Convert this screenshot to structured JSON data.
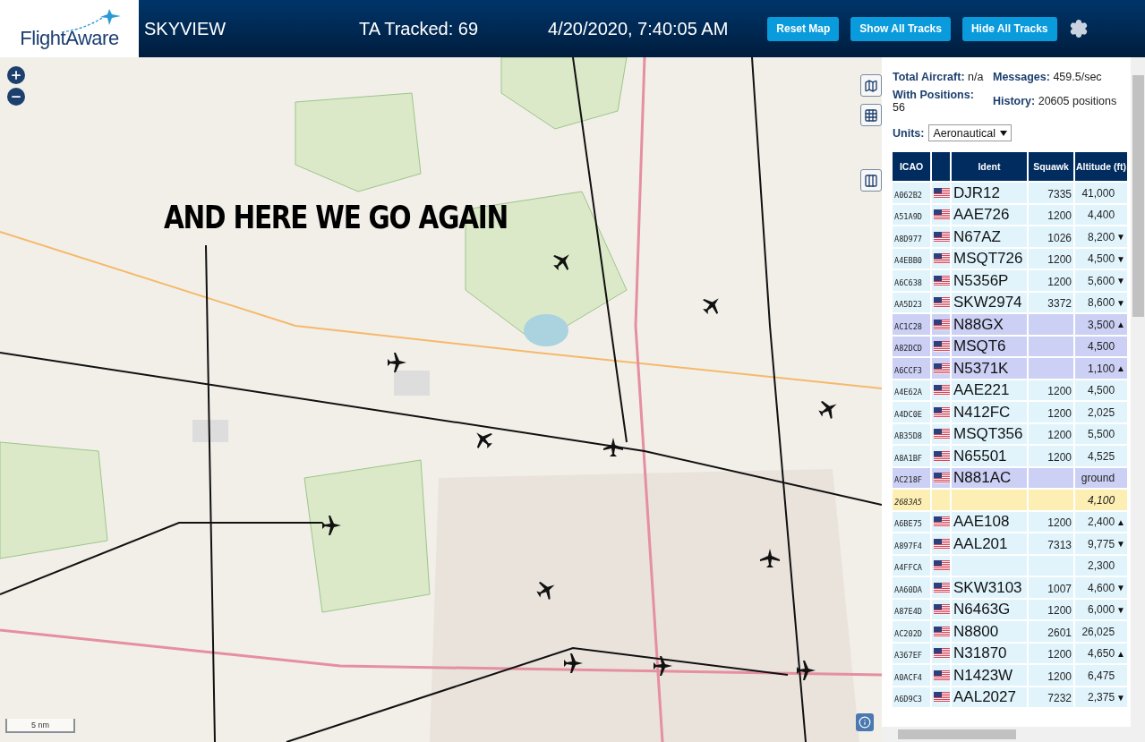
{
  "header": {
    "logo": "FlightAware",
    "title": "SKYVIEW",
    "tracked": "TA Tracked: 69",
    "datetime": "4/20/2020, 7:40:05 AM",
    "buttons": [
      "Reset Map",
      "Show All Tracks",
      "Hide All Tracks"
    ]
  },
  "map": {
    "kind": "picture",
    "caption": "AND HERE WE GO AGAIN",
    "scale": "5 nm"
  },
  "stats": [
    "**Total Aircraft:** n/a",
    "**Messages:** 459.5/sec",
    "**With Positions:** 56",
    "**History:** 20605 positions"
  ],
  "units": {
    "label": "Units:",
    "value": "Aeronautical"
  },
  "table": {
    "columns": [
      "ICAO",
      "Ident",
      "Squawk",
      "Altitude (ft)"
    ],
    "rows": [
      {
        "kind": "standard",
        "icao": "A062B2",
        "flag": true,
        "ident": "DJR12",
        "squawk": "7335",
        "altitude": "41,000"
      },
      {
        "kind": "standard",
        "icao": "A51A9D",
        "flag": true,
        "ident": "AAE726",
        "squawk": "1200",
        "altitude": "4,400"
      },
      {
        "kind": "standard",
        "icao": "A8D977",
        "flag": true,
        "ident": "N67AZ",
        "squawk": "1026",
        "altitude": "8,200",
        "trend": "▼"
      },
      {
        "kind": "standard",
        "icao": "A4EBB0",
        "flag": true,
        "ident": "MSQT726",
        "squawk": "1200",
        "altitude": "4,500",
        "trend": "▼"
      },
      {
        "kind": "standard",
        "icao": "A6C638",
        "flag": true,
        "ident": "N5356P",
        "squawk": "1200",
        "altitude": "5,600",
        "trend": "▼"
      },
      {
        "kind": "standard",
        "icao": "AA5D23",
        "flag": true,
        "ident": "SKW2974",
        "squawk": "3372",
        "altitude": "8,600",
        "trend": "▼"
      },
      {
        "kind": "highlighted",
        "icao": "AC1C28",
        "flag": true,
        "ident": "N88GX",
        "altitude": "3,500",
        "trend": "▲"
      },
      {
        "kind": "highlighted",
        "icao": "A82DCD",
        "flag": true,
        "ident": "MSQT6",
        "altitude": "4,500"
      },
      {
        "kind": "highlighted",
        "icao": "A6CCF3",
        "flag": true,
        "ident": "N5371K",
        "altitude": "1,100",
        "trend": "▲"
      },
      {
        "kind": "standard",
        "icao": "A4E62A",
        "flag": true,
        "ident": "AAE221",
        "squawk": "1200",
        "altitude": "4,500"
      },
      {
        "kind": "standard",
        "icao": "A4DC0E",
        "flag": true,
        "ident": "N412FC",
        "squawk": "1200",
        "altitude": "2,025"
      },
      {
        "kind": "standard",
        "icao": "AB35D8",
        "flag": true,
        "ident": "MSQT356",
        "squawk": "1200",
        "altitude": "5,500"
      },
      {
        "kind": "standard",
        "icao": "A8A1BF",
        "flag": true,
        "ident": "N65501",
        "squawk": "1200",
        "altitude": "4,525"
      },
      {
        "kind": "highlighted",
        "icao": "AC218F",
        "flag": true,
        "ident": "N881AC",
        "altitude": "ground"
      },
      {
        "kind": "other",
        "icao": "2683A5",
        "flag": false,
        "altitude": "4,100"
      },
      {
        "kind": "standard",
        "icao": "A6BE75",
        "flag": true,
        "ident": "AAE108",
        "squawk": "1200",
        "altitude": "2,400",
        "trend": "▲"
      },
      {
        "kind": "standard",
        "icao": "A897F4",
        "flag": true,
        "ident": "AAL201",
        "squawk": "7313",
        "altitude": "9,775",
        "trend": "▼"
      },
      {
        "kind": "standard",
        "icao": "A4FFCA",
        "flag": true,
        "altitude": "2,300"
      },
      {
        "kind": "standard",
        "icao": "AA60DA",
        "flag": true,
        "ident": "SKW3103",
        "squawk": "1007",
        "altitude": "4,600",
        "trend": "▼"
      },
      {
        "kind": "standard",
        "icao": "A87E4D",
        "flag": true,
        "ident": "N6463G",
        "squawk": "1200",
        "altitude": "6,000",
        "trend": "▼"
      },
      {
        "kind": "standard",
        "icao": "AC202D",
        "flag": true,
        "ident": "N8800",
        "squawk": "2601",
        "altitude": "26,025"
      },
      {
        "kind": "standard",
        "icao": "A367EF",
        "flag": true,
        "ident": "N31870",
        "squawk": "1200",
        "altitude": "4,650",
        "trend": "▲"
      },
      {
        "kind": "standard",
        "icao": "A0ACF4",
        "flag": true,
        "ident": "N1423W",
        "squawk": "1200",
        "altitude": "6,475"
      },
      {
        "kind": "standard",
        "icao": "A6D9C3",
        "flag": true,
        "ident": "AAL2027",
        "squawk": "7232",
        "altitude": "2,375",
        "trend": "▼"
      }
    ]
  }
}
